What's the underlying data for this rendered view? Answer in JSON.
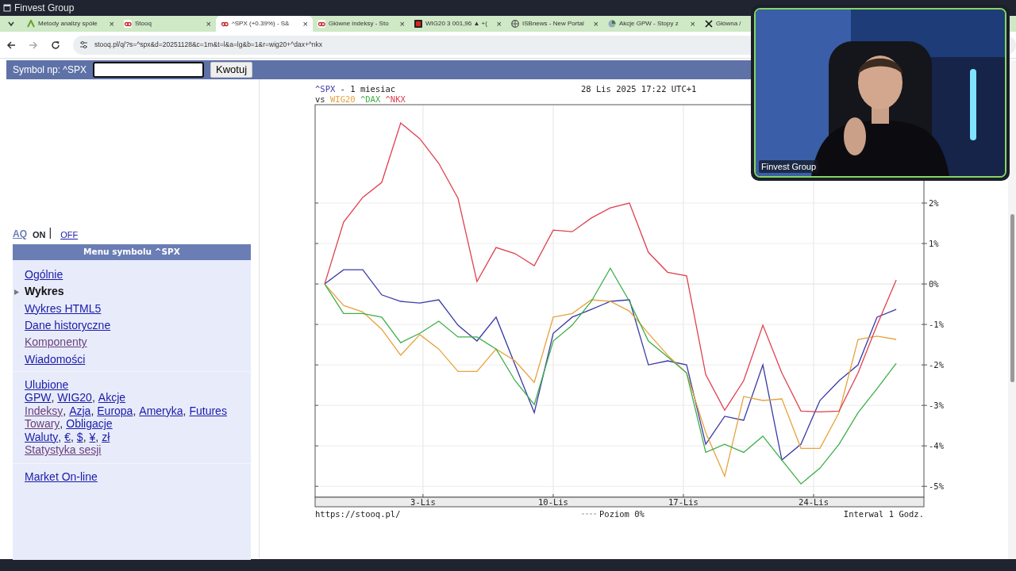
{
  "window": {
    "title": "Finvest Group"
  },
  "tabs": [
    {
      "kind": "finvest",
      "label": "Metody analizy spółe",
      "selected": false,
      "close": "×"
    },
    {
      "kind": "stooq",
      "label": "Stooq",
      "selected": false,
      "close": "×"
    },
    {
      "kind": "stooq",
      "label": "^SPX (+0.39%) - S&",
      "selected": true,
      "close": "×"
    },
    {
      "kind": "stooq",
      "label": "Główne indeksy - Sto",
      "selected": false,
      "close": "×"
    },
    {
      "kind": "square",
      "label": "WIG20 3 001,96 ▲ +(",
      "selected": false,
      "close": "×"
    },
    {
      "kind": "globe",
      "label": "ISBnews - New Portal",
      "selected": false,
      "close": "×"
    },
    {
      "kind": "pie",
      "label": "Akcje GPW - Stopy z",
      "selected": false,
      "close": "×"
    },
    {
      "kind": "x",
      "label": "Główna /",
      "selected": false
    }
  ],
  "address": {
    "url": "stooq.pl/q/?s=^spx&d=20251128&c=1m&t=l&a=lg&b=1&r=wig20+^dax+^nkx"
  },
  "symbol_bar": {
    "label": "Symbol np: ^SPX",
    "button": "Kwotuj"
  },
  "aq": {
    "label": "AQ",
    "separator": "|",
    "options": [
      {
        "label": "ON",
        "selected": true
      },
      {
        "label": "OFF",
        "selected": false
      }
    ]
  },
  "menu": {
    "title": "Menu symbolu ^SPX",
    "items": [
      {
        "label": "Ogólnie",
        "selected": false,
        "visited": false
      },
      {
        "label": "Wykres",
        "selected": true
      },
      {
        "label": "Wykres HTML5",
        "selected": false,
        "visited": false
      },
      {
        "label": "Dane historyczne",
        "selected": false,
        "visited": false
      },
      {
        "label": "Komponenty",
        "selected": false,
        "visited": true
      },
      {
        "label": "Wiadomości",
        "selected": false,
        "visited": false
      }
    ]
  },
  "link_separator": ",",
  "link_groups": [
    [
      {
        "links": [
          {
            "label": "Ulubione",
            "visited": false
          }
        ]
      },
      {
        "links": [
          {
            "label": "GPW",
            "visited": false
          },
          {
            "label": "WIG20",
            "visited": false
          },
          {
            "label": "Akcje",
            "visited": false
          }
        ]
      },
      {
        "links": [
          {
            "label": "Indeksy",
            "visited": true
          },
          {
            "label": "Azja",
            "visited": false
          },
          {
            "label": "Europa",
            "visited": false
          },
          {
            "label": "Ameryka",
            "visited": false
          },
          {
            "label": "Futures",
            "visited": false
          }
        ]
      },
      {
        "links": [
          {
            "label": "Towary",
            "visited": true
          },
          {
            "label": "Obligacje",
            "visited": false
          }
        ]
      },
      {
        "links": [
          {
            "label": "Waluty",
            "visited": false
          },
          {
            "label": "€",
            "visited": false
          },
          {
            "label": "$",
            "visited": false
          },
          {
            "label": "¥",
            "visited": false
          },
          {
            "label": "zł",
            "visited": false
          }
        ]
      },
      {
        "links": [
          {
            "label": "Statystyka sesji",
            "visited": true
          }
        ]
      }
    ],
    [
      {
        "links": [
          {
            "label": "Market On-line",
            "visited": false
          }
        ]
      }
    ]
  ],
  "chart": {
    "period": " - 1 miesiac",
    "timestamp": "28 Lis 2025 17:22 UTC+1",
    "vs": "vs",
    "source": "https://stooq.pl/",
    "zero_label": "Poziom 0%",
    "interval": "Interwal 1 Godz.",
    "chart_data": {
      "type": "line",
      "grid": true,
      "x": [
        -2.29,
        -1.27,
        -0.24,
        0.78,
        1.8,
        2.83,
        3.85,
        4.88,
        5.9,
        6.93,
        7.95,
        8.98,
        10.0,
        11.02,
        12.05,
        13.07,
        14.1,
        15.12,
        16.15,
        17.17,
        18.2,
        19.22,
        20.24,
        21.27,
        22.29,
        23.32,
        24.34,
        25.37,
        26.39,
        27.41,
        28.44
      ],
      "xlim": [
        -2.8,
        29.93
      ],
      "ylim": [
        -5.27,
        4.43
      ],
      "xticks": [
        {
          "value": 3,
          "label": "3-Lis"
        },
        {
          "value": 10,
          "label": "10-Lis"
        },
        {
          "value": 17,
          "label": "17-Lis"
        },
        {
          "value": 24,
          "label": "24-Lis"
        }
      ],
      "yticks": [
        {
          "value": 2,
          "label": "2%"
        },
        {
          "value": 1,
          "label": "1%"
        },
        {
          "value": 0,
          "label": "0%"
        },
        {
          "value": -1,
          "label": "-1%"
        },
        {
          "value": -2,
          "label": "-2%"
        },
        {
          "value": -3,
          "label": "-3%"
        },
        {
          "value": -4,
          "label": "-4%"
        },
        {
          "value": -5,
          "label": "-5%"
        }
      ],
      "series": [
        {
          "name": "^SPX",
          "color": "#3a3aa8",
          "values": [
            0,
            0.35,
            0.35,
            -0.27,
            -0.43,
            -0.47,
            -0.39,
            -1.02,
            -1.41,
            -0.82,
            -2.0,
            -3.18,
            -1.22,
            -0.82,
            -0.63,
            -0.43,
            -0.39,
            -2.0,
            -1.9,
            -2.0,
            -3.96,
            -3.27,
            -3.37,
            -2.0,
            -4.35,
            -3.96,
            -2.88,
            -2.39,
            -2.0,
            -0.82,
            -0.63
          ]
        },
        {
          "name": "WIG20",
          "color": "#e8a23c",
          "values": [
            0,
            -0.53,
            -0.69,
            -1.12,
            -1.76,
            -1.25,
            -1.61,
            -2.16,
            -2.16,
            -1.61,
            -1.9,
            -2.43,
            -0.82,
            -0.73,
            -0.39,
            -0.43,
            -0.67,
            -1.22,
            -1.76,
            -2.2,
            -3.67,
            -4.75,
            -2.78,
            -2.88,
            -2.84,
            -4.06,
            -4.06,
            -3.18,
            -1.37,
            -1.29,
            -1.37
          ]
        },
        {
          "name": "^DAX",
          "color": "#3fae49",
          "values": [
            0,
            -0.73,
            -0.73,
            -0.82,
            -1.45,
            -1.22,
            -0.92,
            -1.31,
            -1.31,
            -1.61,
            -2.39,
            -2.98,
            -1.41,
            -1.02,
            -0.43,
            0.39,
            -0.43,
            -1.41,
            -1.8,
            -2.2,
            -4.16,
            -3.96,
            -4.16,
            -3.76,
            -4.35,
            -4.94,
            -4.55,
            -3.96,
            -3.18,
            -2.59,
            -1.96
          ]
        },
        {
          "name": "^NKX",
          "color": "#e0404e",
          "values": [
            0,
            1.53,
            2.14,
            2.51,
            3.98,
            3.59,
            2.98,
            2.12,
            0.06,
            0.9,
            0.75,
            0.45,
            1.33,
            1.29,
            1.63,
            1.88,
            2.0,
            0.78,
            0.29,
            0.2,
            -2.24,
            -3.12,
            -2.39,
            -1.02,
            -2.2,
            -3.14,
            -3.16,
            -3.14,
            -2.2,
            -1.02,
            0.1
          ]
        }
      ]
    }
  },
  "video": {
    "kind": "picture",
    "caption": "Finvest Group"
  }
}
